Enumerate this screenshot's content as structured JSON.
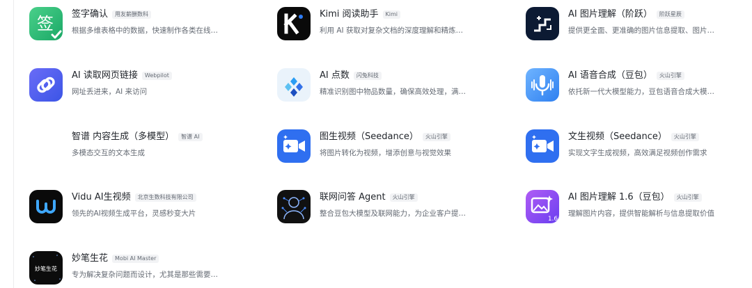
{
  "plugins": [
    {
      "title": "签字确认",
      "badge": "用友薪酬数科",
      "desc": "根据多维表格中的数据，快速制作各类在线…",
      "icon": "signature-confirm-icon"
    },
    {
      "title": "Kimi 阅读助手",
      "badge": "Kimi",
      "desc": "利用 AI 获取对复杂文档的深度理解和精炼…",
      "icon": "kimi-logo-icon"
    },
    {
      "title": "AI 图片理解（阶跃）",
      "badge": "阶跃星辰",
      "desc": "提供更全面、更准确的图片信息提取、图片…",
      "icon": "stepfun-logo-icon"
    },
    {
      "title": "AI 读取网页链接",
      "badge": "Webpilot",
      "desc": "网址丢进来，AI 来访问",
      "icon": "link-icon"
    },
    {
      "title": "AI 点数",
      "badge": "闪兔科技",
      "desc": "精准识别图中物品数量，确保高效处理，满…",
      "icon": "dot-count-icon"
    },
    {
      "title": "AI 语音合成（豆包）",
      "badge": "火山引擎",
      "desc": "依托新一代大模型能力，豆包语音合成大模…",
      "icon": "microphone-icon"
    },
    {
      "title": "智谱 内容生成（多模型）",
      "badge": "智谱 AI",
      "desc": "多模态交互的文本生成",
      "icon": "zhipu-icon"
    },
    {
      "title": "图生视频（Seedance）",
      "badge": "火山引擎",
      "desc": "将图片转化为视频，增添创意与视觉效果",
      "icon": "video-camera-icon"
    },
    {
      "title": "文生视频（Seedance）",
      "badge": "火山引擎",
      "desc": "实现文字生成视频，高效满足视频创作需求",
      "icon": "video-camera-icon"
    },
    {
      "title": "Vidu AI生视频",
      "badge": "北京生数科技有限公司",
      "desc": "领先的AI视频生成平台，灵感秒变大片",
      "icon": "vidu-logo-icon"
    },
    {
      "title": "联网问答 Agent",
      "badge": "火山引擎",
      "desc": "整合豆包大模型及联网能力，为企业客户提…",
      "icon": "web-agent-icon"
    },
    {
      "title": "AI 图片理解 1.6（豆包）",
      "badge": "火山引擎",
      "desc": "理解图片内容，提供智能解析与信息提取价值",
      "icon": "image-understand-icon"
    },
    {
      "title": "妙笔生花",
      "badge": "Mobi AI Master",
      "desc": "专为解决复杂问题而设计，尤其是那些需要…",
      "icon": "miaobi-logo-icon"
    }
  ],
  "icon_texts": {
    "miaobi": "妙笔生花",
    "version": "1.6"
  }
}
